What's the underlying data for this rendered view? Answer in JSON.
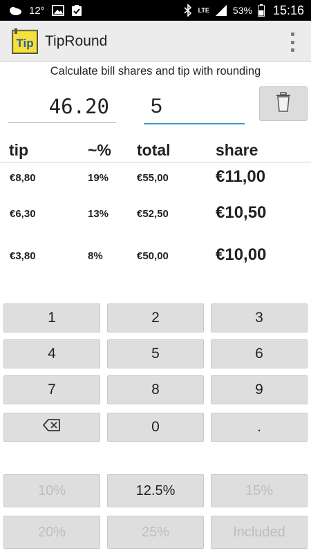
{
  "status_bar": {
    "temperature": "12°",
    "lte": "LTE",
    "battery": "53%",
    "time": "15:16"
  },
  "app": {
    "title": "TipRound",
    "logo_text": "Tip"
  },
  "subtitle": "Calculate bill shares and tip with rounding",
  "inputs": {
    "bill_amount": "46.20",
    "people": "5"
  },
  "table": {
    "headers": {
      "tip": "tip",
      "percent": "~%",
      "total": "total",
      "share": "share"
    },
    "rows": [
      {
        "tip": "€8,80",
        "percent": "19%",
        "total": "€55,00",
        "share": "€11,00"
      },
      {
        "tip": "€6,30",
        "percent": "13%",
        "total": "€52,50",
        "share": "€10,50"
      },
      {
        "tip": "€3,80",
        "percent": "8%",
        "total": "€50,00",
        "share": "€10,00"
      }
    ]
  },
  "keypad": {
    "k1": "1",
    "k2": "2",
    "k3": "3",
    "k4": "4",
    "k5": "5",
    "k6": "6",
    "k7": "7",
    "k8": "8",
    "k9": "9",
    "backspace": "⌫",
    "k0": "0",
    "dot": "."
  },
  "tip_buttons": {
    "p10": "10%",
    "p125": "12.5%",
    "p15": "15%",
    "p20": "20%",
    "p25": "25%",
    "included": "Included"
  },
  "colors": {
    "accent": "#3b97c6",
    "key_bg": "#dedede",
    "disabled_text": "#bdbdbd",
    "logo_bg": "#f5e13a"
  }
}
